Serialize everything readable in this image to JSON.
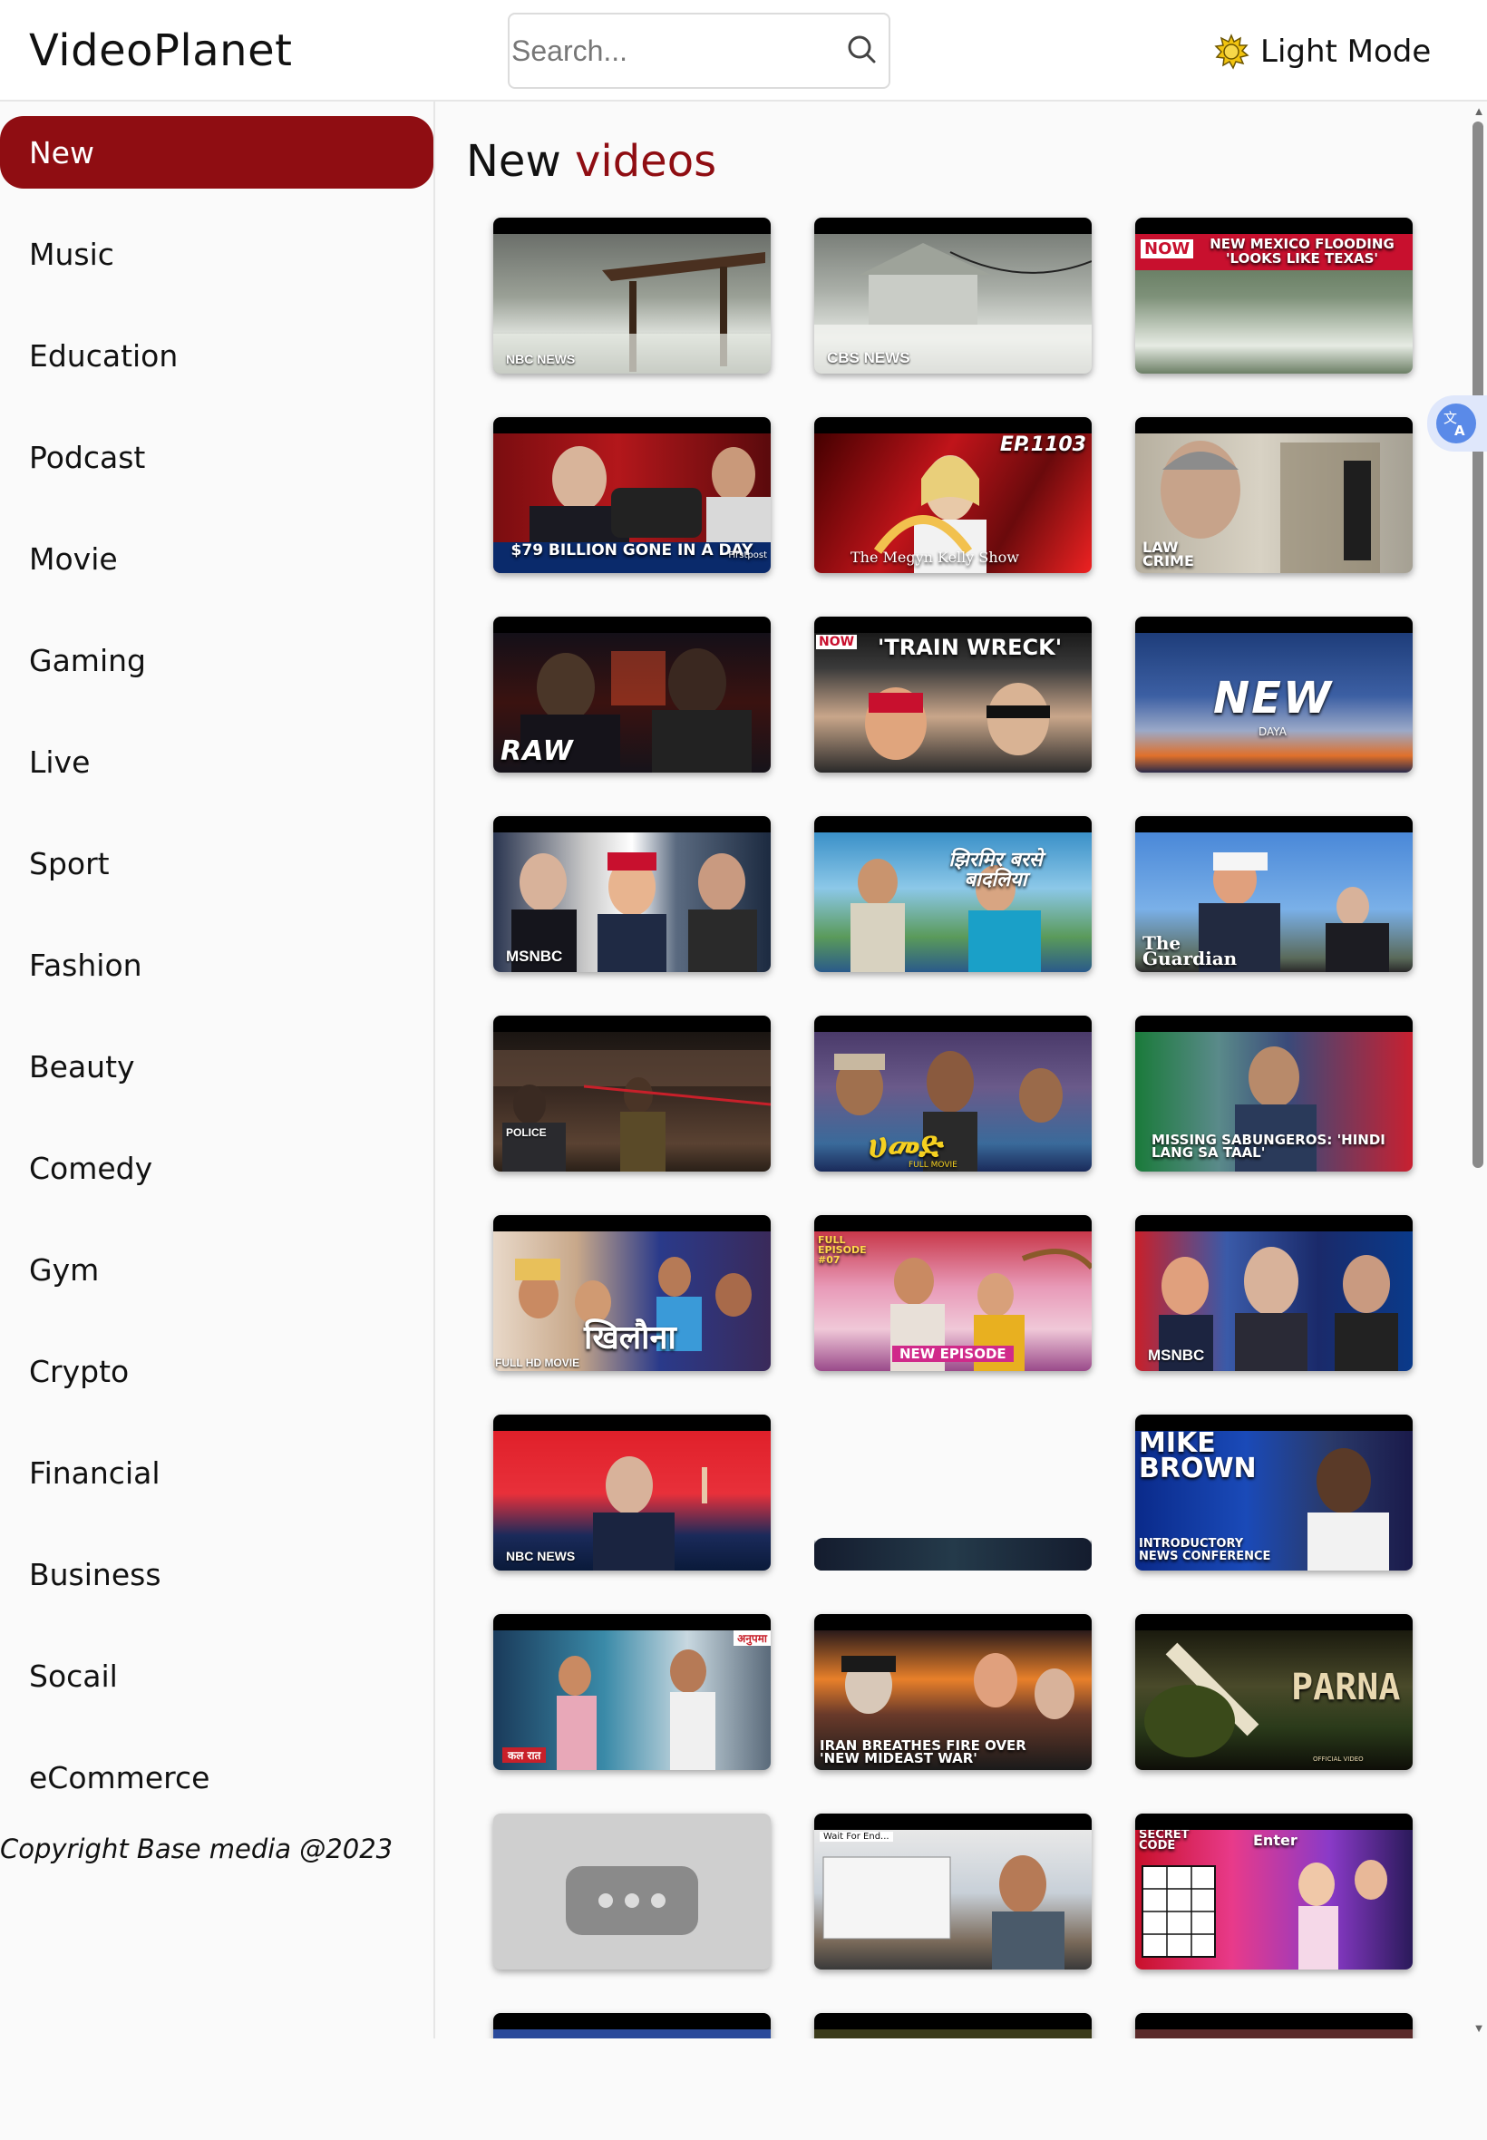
{
  "header": {
    "logo": "VideoPlanet",
    "search_placeholder": "Search...",
    "mode_label": "Light Mode"
  },
  "sidebar": {
    "items": [
      {
        "label": "New",
        "active": true
      },
      {
        "label": "Music"
      },
      {
        "label": "Education"
      },
      {
        "label": "Podcast"
      },
      {
        "label": "Movie"
      },
      {
        "label": "Gaming"
      },
      {
        "label": "Live"
      },
      {
        "label": "Sport"
      },
      {
        "label": "Fashion"
      },
      {
        "label": "Beauty"
      },
      {
        "label": "Comedy"
      },
      {
        "label": "Gym"
      },
      {
        "label": "Crypto"
      },
      {
        "label": "Financial"
      },
      {
        "label": "Business"
      },
      {
        "label": "Socail"
      },
      {
        "label": "eCommerce"
      }
    ],
    "copyright": "Copyright Base media @2023"
  },
  "main": {
    "title_prefix": "New",
    "title_accent": "videos",
    "videos": [
      {
        "caption": "NBC NEWS"
      },
      {
        "caption": "CBS NEWS"
      },
      {
        "caption": "NEW MEXICO FLOODING 'LOOKS LIKE TEXAS'",
        "badge": "NOW"
      },
      {
        "caption": "$79 BILLION GONE IN A DAY",
        "badge": "Firstpost"
      },
      {
        "caption": "The Megyn Kelly Show",
        "badge": "EP.1103"
      },
      {
        "caption": "LAW CRIME"
      },
      {
        "caption": "RAW"
      },
      {
        "caption": "'TRAIN WRECK'",
        "badge": "NOW"
      },
      {
        "caption": "NEW",
        "badge": "DAYA"
      },
      {
        "caption": "MSNBC"
      },
      {
        "caption": "झिरमिर बरसे बादलिया"
      },
      {
        "caption": "The Guardian"
      },
      {
        "caption": "POLICE"
      },
      {
        "caption": "ሀመድ",
        "badge": "FULL MOVIE"
      },
      {
        "caption": "MISSING SABUNGEROS: 'HINDI LANG SA TAAL'"
      },
      {
        "caption": "FULL HD MOVIE",
        "badge": "खिलौना"
      },
      {
        "caption": "NEW EPISODE",
        "badge": "FULL EPISODE #07"
      },
      {
        "caption": "MSNBC"
      },
      {
        "caption": "NBC NEWS"
      },
      {
        "caption": ""
      },
      {
        "caption": "MIKE BROWN",
        "badge": "INTRODUCTORY NEWS CONFERENCE"
      },
      {
        "caption": "कल रात",
        "badge": "अनुपमा"
      },
      {
        "caption": "IRAN BREATHES FIRE OVER 'NEW MIDEAST WAR'"
      },
      {
        "caption": "PARNA",
        "badge": "OFFICIAL VIDEO"
      },
      {
        "caption": ""
      },
      {
        "caption": "Wait For End..."
      },
      {
        "caption": "SECRET CODE",
        "badge": "Enter"
      }
    ]
  },
  "colors": {
    "accent": "#8f0d12",
    "translate_bg": "#dfe7fb"
  }
}
